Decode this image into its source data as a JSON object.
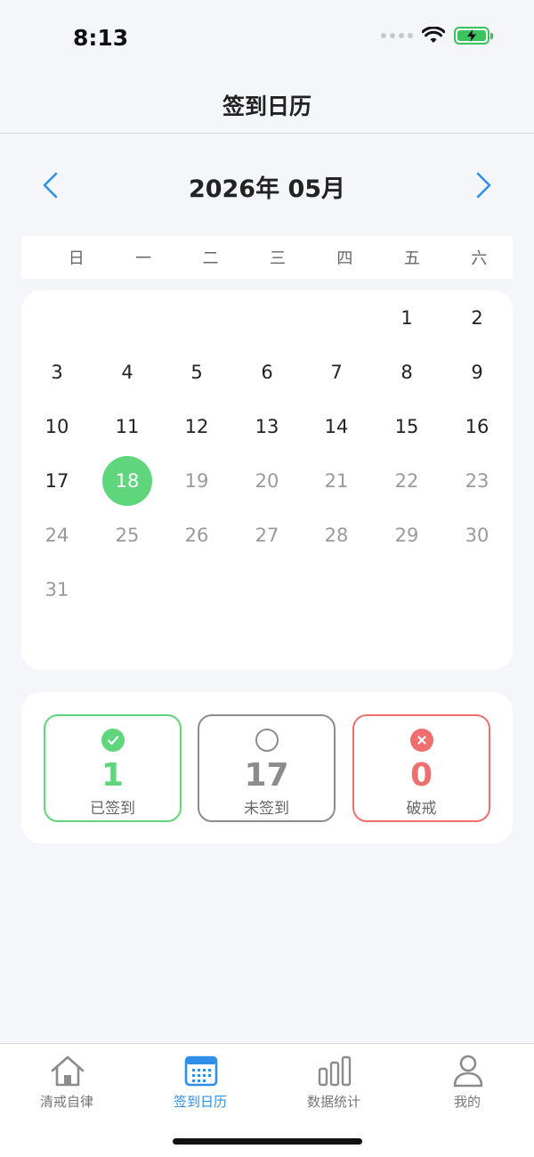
{
  "status_bar": {
    "time": "8:13"
  },
  "nav": {
    "title": "签到日历"
  },
  "calendar": {
    "month_title": "2026年 05月",
    "weekdays": [
      "日",
      "一",
      "二",
      "三",
      "四",
      "五",
      "六"
    ],
    "today": "18",
    "days": [
      [
        "",
        "",
        "",
        "",
        "",
        "1",
        "2"
      ],
      [
        "3",
        "4",
        "5",
        "6",
        "7",
        "8",
        "9"
      ],
      [
        "10",
        "11",
        "12",
        "13",
        "14",
        "15",
        "16"
      ],
      [
        "17",
        "18",
        "19",
        "20",
        "21",
        "22",
        "23"
      ],
      [
        "24",
        "25",
        "26",
        "27",
        "28",
        "29",
        "30"
      ],
      [
        "31",
        "",
        "",
        "",
        "",
        "",
        ""
      ]
    ]
  },
  "stats": {
    "signed": {
      "value": "1",
      "label": "已签到"
    },
    "unsigned": {
      "value": "17",
      "label": "未签到"
    },
    "broken": {
      "value": "0",
      "label": "破戒"
    }
  },
  "tabs": [
    {
      "label": "清戒自律"
    },
    {
      "label": "签到日历"
    },
    {
      "label": "数据统计"
    },
    {
      "label": "我的"
    }
  ],
  "colors": {
    "accent": "#2f8fe6",
    "green": "#5fd67b",
    "gray": "#8c8c8c",
    "red": "#ef6f6f"
  }
}
